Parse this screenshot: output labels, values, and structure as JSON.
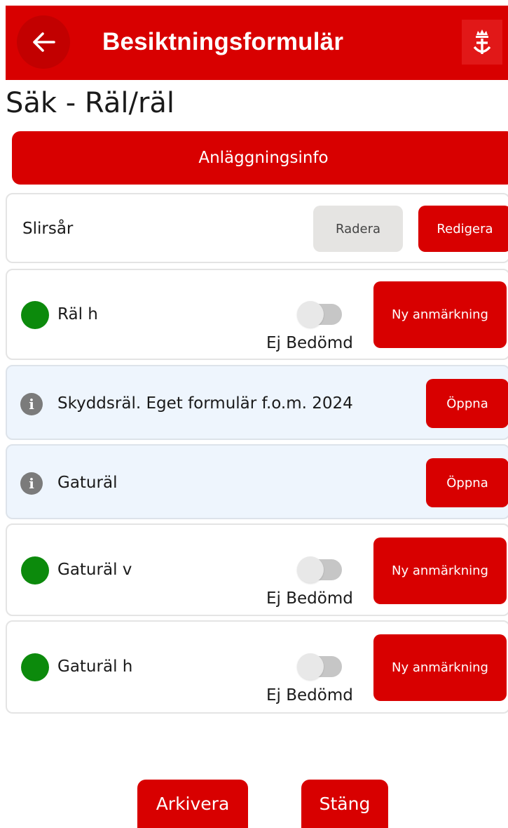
{
  "header": {
    "title": "Besiktningsformulär",
    "back_icon": "arrow-left-icon",
    "logo_icon": "crown-emblem-icon"
  },
  "page_title": "Säk - Räl/räl",
  "info_button_label": "Anläggningsinfo",
  "section": {
    "label": "Slirsår",
    "delete_label": "Radera",
    "edit_label": "Redigera"
  },
  "items": [
    {
      "type": "assess",
      "label": "Räl h",
      "status_color": "#0c8a0c",
      "toggle_label": "Ej Bedömd",
      "button_label": "Ny anmärkning"
    },
    {
      "type": "info",
      "label": "Skyddsräl. Eget formulär f.o.m. 2024",
      "button_label": "Öppna"
    },
    {
      "type": "info",
      "label": "Gaturäl",
      "button_label": "Öppna"
    },
    {
      "type": "assess",
      "label": "Gaturäl v",
      "status_color": "#0c8a0c",
      "toggle_label": "Ej Bedömd",
      "button_label": "Ny anmärkning"
    },
    {
      "type": "assess",
      "label": "Gaturäl h",
      "status_color": "#0c8a0c",
      "toggle_label": "Ej Bedömd",
      "button_label": "Ny anmärkning"
    }
  ],
  "footer": {
    "archive_label": "Arkivera",
    "close_label": "Stäng"
  },
  "colors": {
    "primary": "#d80000",
    "info_background": "#eef5fd",
    "status_green": "#0c8a0c"
  }
}
